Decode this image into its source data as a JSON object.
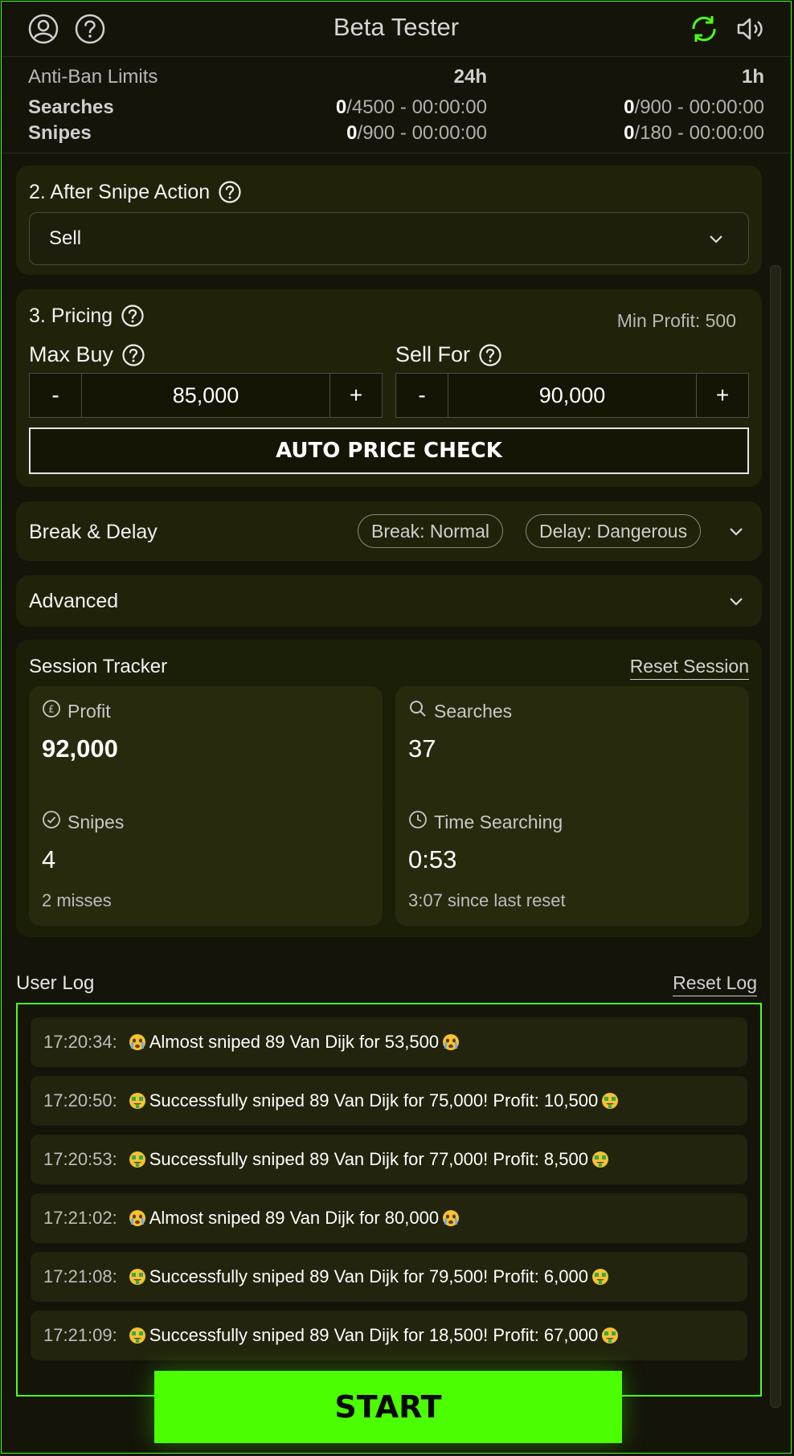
{
  "header": {
    "title": "Beta Tester"
  },
  "limits": {
    "title": "Anti-Ban Limits",
    "col_24h": "24h",
    "col_1h": "1h",
    "rows": [
      {
        "label": "Searches",
        "d_count": "0",
        "d_rest": "/4500 - 00:00:00",
        "h_count": "0",
        "h_rest": "/900 - 00:00:00"
      },
      {
        "label": "Snipes",
        "d_count": "0",
        "d_rest": "/900 - 00:00:00",
        "h_count": "0",
        "h_rest": "/180 - 00:00:00"
      }
    ]
  },
  "after_snipe": {
    "title": "2. After Snipe Action",
    "value": "Sell"
  },
  "pricing": {
    "title": "3. Pricing",
    "min_profit": "Min Profit: 500",
    "max_buy_label": "Max Buy",
    "max_buy_value": "85,000",
    "sell_for_label": "Sell For",
    "sell_for_value": "90,000",
    "minus": "-",
    "plus": "+",
    "auto_price_check": "AUTO PRICE CHECK"
  },
  "break_delay": {
    "title": "Break & Delay",
    "break_pill": "Break: Normal",
    "delay_pill": "Delay: Dangerous"
  },
  "advanced": {
    "title": "Advanced"
  },
  "session": {
    "title": "Session Tracker",
    "reset": "Reset Session",
    "profit": {
      "label": "Profit",
      "value": "92,000"
    },
    "searches": {
      "label": "Searches",
      "value": "37"
    },
    "snipes": {
      "label": "Snipes",
      "value": "4",
      "sub": "2 misses"
    },
    "time": {
      "label": "Time Searching",
      "value": "0:53",
      "sub": "3:07 since last reset"
    }
  },
  "user_log": {
    "title": "User Log",
    "reset": "Reset Log",
    "entries": [
      {
        "time": "17:20:34:",
        "emoji": "crying-face-icon",
        "text": "Almost sniped 89 Van Dijk for 53,500",
        "end_emoji": "crying-face-icon"
      },
      {
        "time": "17:20:50:",
        "emoji": "money-face-icon",
        "text": "Successfully sniped 89 Van Dijk for 75,000! Profit: 10,500",
        "end_emoji": "money-face-icon"
      },
      {
        "time": "17:20:53:",
        "emoji": "money-face-icon",
        "text": "Successfully sniped 89 Van Dijk for 77,000! Profit: 8,500",
        "end_emoji": "money-face-icon"
      },
      {
        "time": "17:21:02:",
        "emoji": "crying-face-icon",
        "text": "Almost sniped 89 Van Dijk for 80,000",
        "end_emoji": "crying-face-icon"
      },
      {
        "time": "17:21:08:",
        "emoji": "money-face-icon",
        "text": "Successfully sniped 89 Van Dijk for 79,500! Profit: 6,000",
        "end_emoji": "money-face-icon"
      },
      {
        "time": "17:21:09:",
        "emoji": "money-face-icon",
        "text": "Successfully sniped 89 Van Dijk for 18,500! Profit: 67,000",
        "end_emoji": "money-face-icon"
      }
    ]
  },
  "start_button": "START",
  "colors": {
    "accent": "#4cff00",
    "panel": "#202309",
    "background": "#141409"
  }
}
